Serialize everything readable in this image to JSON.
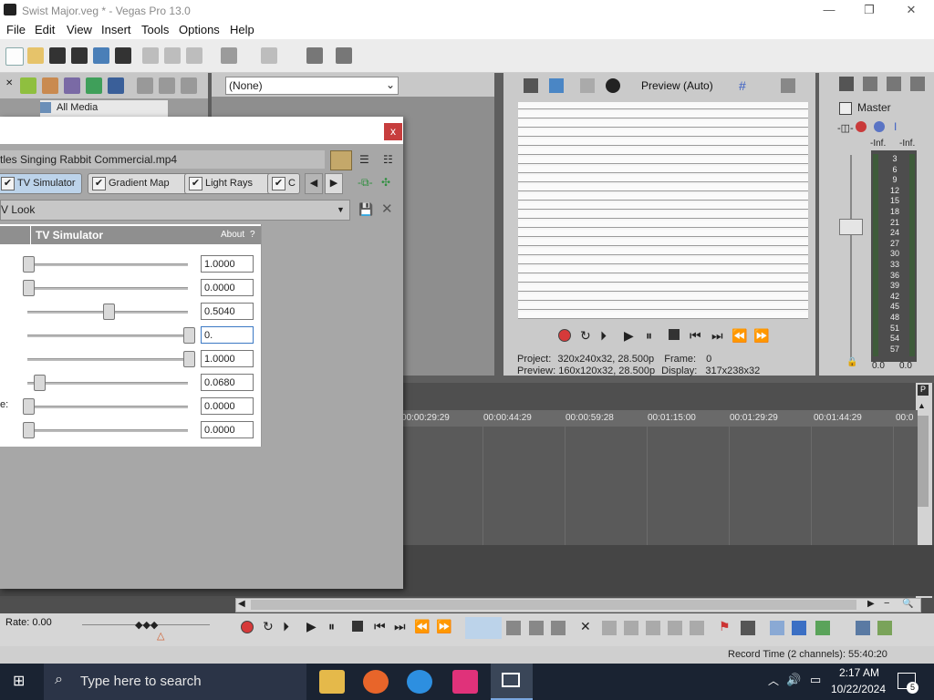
{
  "window": {
    "title": "Swist Major.veg * - Vegas Pro 13.0"
  },
  "menu": [
    "File",
    "Edit",
    "View",
    "Insert",
    "Tools",
    "Options",
    "Help"
  ],
  "media": {
    "tab_label": "All Media"
  },
  "fx_dropdown": {
    "value": "(None)"
  },
  "preview": {
    "mode_label": "Preview (Auto)",
    "project_label": "Project:",
    "project_value": "320x240x32, 28.500p",
    "preview_label": "Preview:",
    "preview_value": "160x120x32, 28.500p",
    "frame_label": "Frame:",
    "frame_value": "0",
    "display_label": "Display:",
    "display_value": "317x238x32"
  },
  "master": {
    "title": "Master",
    "inf_left": "-Inf.",
    "inf_right": "-Inf.",
    "scale": [
      "3",
      "6",
      "9",
      "12",
      "15",
      "18",
      "21",
      "24",
      "27",
      "30",
      "33",
      "36",
      "39",
      "42",
      "45",
      "48",
      "51",
      "54",
      "57"
    ],
    "bottom_left": "0.0",
    "bottom_right": "0.0"
  },
  "timeline": {
    "ruler": [
      "00:00:29:29",
      "00:00:44:29",
      "00:00:59:28",
      "00:01:15:00",
      "00:01:29:29",
      "00:01:44:29",
      "00:0"
    ]
  },
  "rate": "Rate: 0.00",
  "status": {
    "record_time": "Record Time (2 channels): 55:40:20"
  },
  "dialog": {
    "close": "x",
    "clip_name": "tles Singing Rabbit Commercial.mp4",
    "chain": [
      "TV Simulator",
      "Gradient Map",
      "Light Rays",
      "C"
    ],
    "preset": "V Look",
    "panel_title": "TV Simulator",
    "about": "About",
    "help": "?",
    "head_left": "",
    "param_labels": [
      "",
      "",
      "",
      "",
      "",
      "",
      "e:",
      ""
    ],
    "params": [
      {
        "value": "1.0000",
        "level": 0.0
      },
      {
        "value": "0.0000",
        "level": 0.0
      },
      {
        "value": "0.5040",
        "level": 0.5
      },
      {
        "value": "0.",
        "level": 1.0
      },
      {
        "value": "1.0000",
        "level": 1.0
      },
      {
        "value": "0.0680",
        "level": 0.07
      },
      {
        "value": "0.0000",
        "level": 0.0
      },
      {
        "value": "0.0000",
        "level": 0.0
      }
    ]
  },
  "taskbar": {
    "search_placeholder": "Type here to search",
    "time": "2:17 AM",
    "date": "10/22/2024",
    "notifications": "5"
  },
  "colors": {
    "close_red": "#c73e3e",
    "accent_blue": "#3c79c4",
    "record_red": "#d63a3a"
  }
}
